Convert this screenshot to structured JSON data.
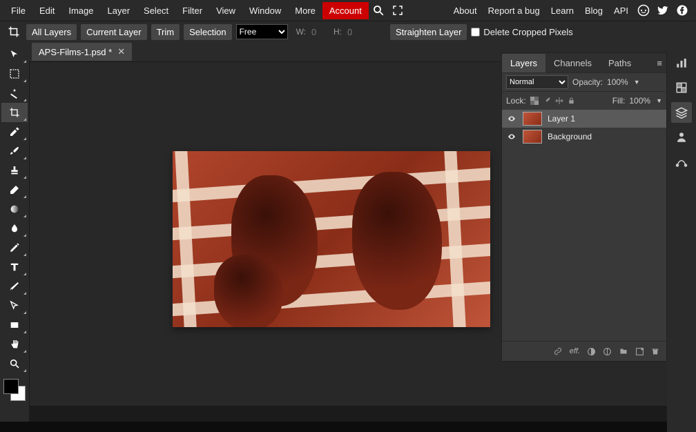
{
  "menu": {
    "file": "File",
    "edit": "Edit",
    "image": "Image",
    "layer": "Layer",
    "select": "Select",
    "filter": "Filter",
    "view": "View",
    "window": "Window",
    "more": "More",
    "account": "Account"
  },
  "toplinks": {
    "about": "About",
    "report": "Report a bug",
    "learn": "Learn",
    "blog": "Blog",
    "api": "API"
  },
  "options": {
    "all_layers": "All Layers",
    "current_layer": "Current Layer",
    "trim": "Trim",
    "selection": "Selection",
    "ratio": "Free",
    "wlabel": "W:",
    "wval": "0",
    "hlabel": "H:",
    "hval": "0",
    "straighten": "Straighten Layer",
    "delete_cropped": "Delete Cropped Pixels"
  },
  "tab": {
    "name": "APS-Films-1.psd *"
  },
  "panels": {
    "tabs": {
      "layers": "Layers",
      "channels": "Channels",
      "paths": "Paths"
    },
    "blend": "Normal",
    "opacity_label": "Opacity:",
    "opacity_value": "100%",
    "lock_label": "Lock:",
    "fill_label": "Fill:",
    "fill_value": "100%",
    "layers": [
      {
        "name": "Layer 1",
        "selected": true,
        "visible": true
      },
      {
        "name": "Background",
        "selected": false,
        "visible": true
      }
    ],
    "footer_fx": "eff."
  }
}
